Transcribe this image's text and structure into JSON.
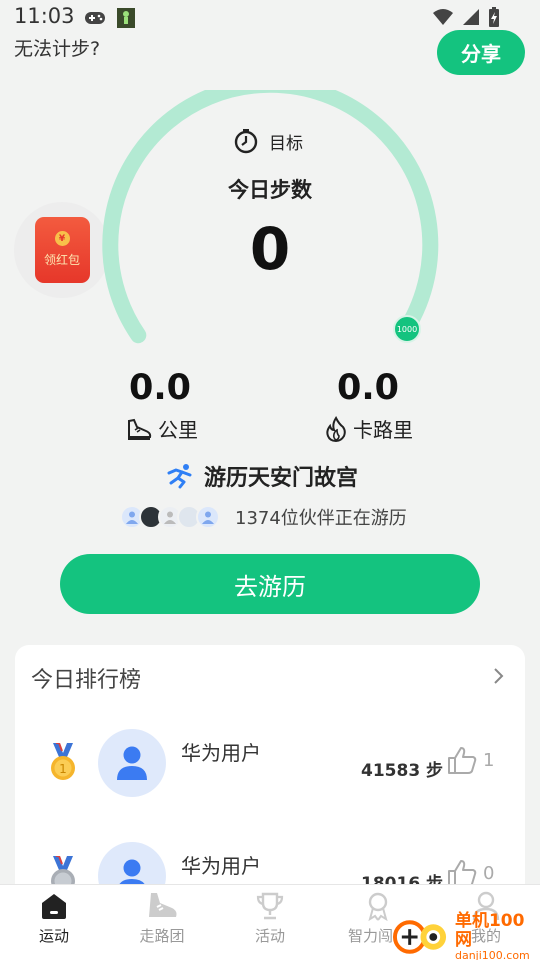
{
  "status_bar": {
    "time": "11:03"
  },
  "header": {
    "cant_count_text": "无法计步?",
    "share_label": "分享"
  },
  "red_packet": {
    "label": "领红包",
    "coin_symbol": "¥"
  },
  "gauge": {
    "target_label": "目标",
    "today_steps_label": "今日步数",
    "steps_value": "0",
    "goal_value": "1000",
    "progress": 0.0
  },
  "stats": {
    "distance": {
      "value": "0.0",
      "label": "公里"
    },
    "calories": {
      "value": "0.0",
      "label": "卡路里"
    }
  },
  "tour": {
    "title": "游历天安门故宫",
    "partners_text": "1374位伙伴正在游历",
    "go_label": "去游历"
  },
  "ranking": {
    "title": "今日排行榜",
    "rows": [
      {
        "name": "华为用户",
        "steps": "41583 步",
        "likes": "1",
        "medal": "gold"
      },
      {
        "name": "华为用户",
        "steps": "18016 步",
        "likes": "0",
        "medal": "silver"
      }
    ]
  },
  "bottom_nav": {
    "items": [
      {
        "label": "运动",
        "icon": "home-icon",
        "active": true
      },
      {
        "label": "走路团",
        "icon": "shoe-icon",
        "active": false
      },
      {
        "label": "活动",
        "icon": "trophy-icon",
        "active": false
      },
      {
        "label": "智力闯关",
        "icon": "medal-icon",
        "active": false
      },
      {
        "label": "我的",
        "icon": "person-icon",
        "active": false
      }
    ]
  },
  "watermark": {
    "text": "单机100网",
    "sub": "danji100.com"
  },
  "colors": {
    "accent": "#14c37f",
    "gauge_track": "#b3ead3",
    "red_packet": "#e6372a",
    "avatar_bg": "#dfe9fb",
    "avatar_fg": "#3b7bf2"
  }
}
